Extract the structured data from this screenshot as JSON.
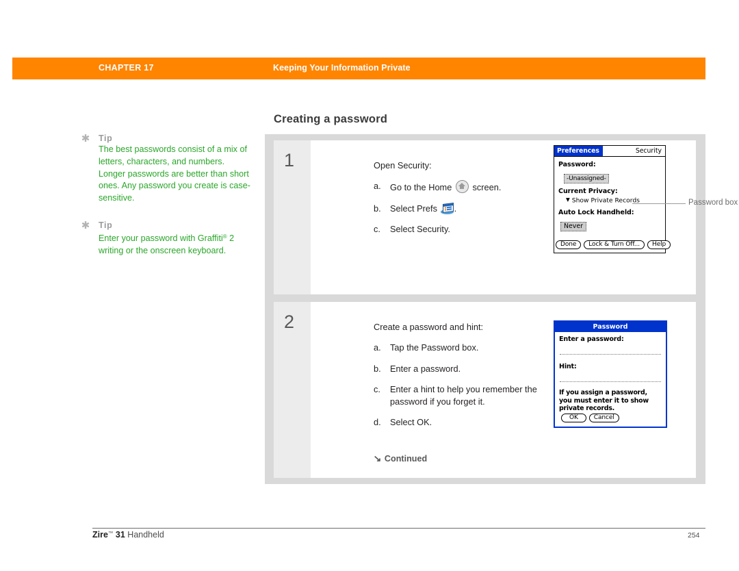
{
  "header": {
    "chapter_label": "CHAPTER 17",
    "chapter_title": "Keeping Your Information Private",
    "bar_color": "#ff8400"
  },
  "section": {
    "heading": "Creating a password"
  },
  "tips": [
    {
      "star_icon": "asterisk-icon",
      "label": "Tip",
      "body": "The best passwords consist of a mix of letters, characters, and numbers. Longer passwords are better than short ones. Any password you create is case-sensitive.",
      "color": "#2aa62a"
    },
    {
      "star_icon": "asterisk-icon",
      "label": "Tip",
      "body_part1": "Enter your password with Graffiti",
      "body_sup": "®",
      "body_part2": " 2 writing or the onscreen keyboard.",
      "color": "#2aa62a"
    }
  ],
  "steps": [
    {
      "number": "1",
      "lead": "Open Security:",
      "items": [
        {
          "marker": "a.",
          "text_before": "Go to the Home",
          "icon": "home-icon",
          "text_after": "screen."
        },
        {
          "marker": "b.",
          "text_before": "Select Prefs",
          "icon": "prefs-icon",
          "text_after": "."
        },
        {
          "marker": "c.",
          "text_before": "Select Security.",
          "icon": "",
          "text_after": ""
        }
      ]
    },
    {
      "number": "2",
      "lead": "Create a password and hint:",
      "items": [
        {
          "marker": "a.",
          "text": "Tap the Password box."
        },
        {
          "marker": "b.",
          "text": "Enter a password."
        },
        {
          "marker": "c.",
          "text": "Enter a hint to help you remember the password if you forget it."
        },
        {
          "marker": "d.",
          "text": "Select OK."
        }
      ],
      "continued_arrow": "↘",
      "continued_label": "Continued"
    }
  ],
  "security_screen": {
    "tab_label": "Preferences",
    "app_label": "Security",
    "password_label": "Password:",
    "password_value": "-Unassigned-",
    "privacy_label": "Current Privacy:",
    "privacy_value": "Show Private Records",
    "privacy_triangle": "▼",
    "autolock_label": "Auto Lock Handheld:",
    "autolock_value": "Never",
    "buttons": [
      "Done",
      "Lock & Turn Off...",
      "Help"
    ],
    "title_color": "#0033cc"
  },
  "password_screen": {
    "title": "Password",
    "enter_label": "Enter a password:",
    "hint_label": "Hint:",
    "note": "If you assign a password, you must enter it to show private records.",
    "buttons": [
      "OK",
      "Cancel"
    ],
    "title_color": "#0033cc"
  },
  "callout": {
    "label": "Password box"
  },
  "footer": {
    "product_bold1": "Zire",
    "product_sup": "™",
    "product_bold2": " 31",
    "product_rest": " Handheld",
    "page_number": "254"
  }
}
